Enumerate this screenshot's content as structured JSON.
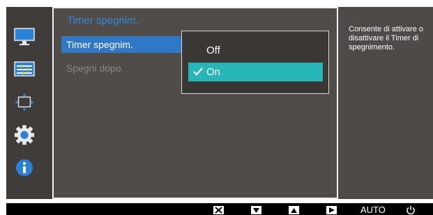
{
  "menu": {
    "title": "Timer spegnim.",
    "items": [
      {
        "label": "Timer spegnim."
      },
      {
        "label": "Spegni dopo"
      }
    ]
  },
  "dropdown": {
    "options": [
      {
        "label": "Off",
        "selected": false
      },
      {
        "label": "On",
        "selected": true
      }
    ]
  },
  "help": {
    "text": "Consente di attivare o\ndisattivare il Timer di\nspegnimento."
  },
  "bottom_bar": {
    "auto_label": "AUTO"
  },
  "colors": {
    "accent_title": "#2f8bd8",
    "selected_item": "#2f78c8",
    "selected_option": "#27b7b9",
    "osd_background": "#4d4a48"
  },
  "sidebar_icons": [
    "monitor-icon",
    "picture-settings-icon",
    "position-size-icon",
    "gear-icon",
    "info-icon"
  ],
  "bottom_icons": [
    "close-icon",
    "down-arrow-icon",
    "up-arrow-icon",
    "right-arrow-icon",
    "auto-label",
    "power-icon"
  ]
}
